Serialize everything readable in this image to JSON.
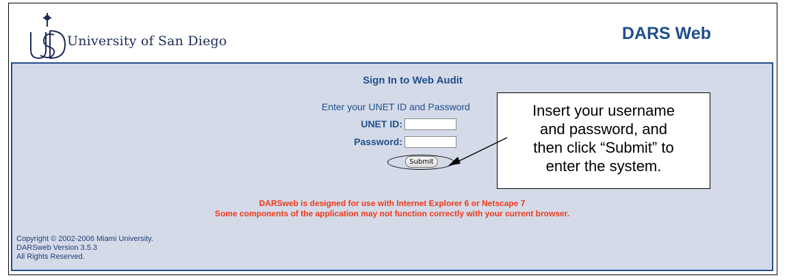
{
  "header": {
    "university_name": "University of San Diego",
    "app_title": "DARS Web"
  },
  "signin": {
    "title": "Sign In to Web Audit",
    "instructions": "Enter your UNET ID and Password",
    "unet_label": "UNET ID:",
    "password_label": "Password:",
    "unet_value": "",
    "password_value": "",
    "submit_label": "Submit"
  },
  "warning": {
    "line1": "DARSweb is designed for use with Internet Explorer 6 or Netscape 7",
    "line2": "Some components of the application may not function correctly with your current browser."
  },
  "footer": {
    "line1": "Copyright © 2002-2006 Miami University.",
    "line2": "DARSweb Version 3.5.3",
    "line3": "All Rights Reserved."
  },
  "callout": {
    "line1": "Insert your username",
    "line2": "and password, and",
    "line3": "then click “Submit” to",
    "line4": "enter the system."
  },
  "colors": {
    "brand_blue": "#1f4e8c",
    "panel_bg": "#d4dae8",
    "warning_red": "#f0391a"
  },
  "icons": {
    "logo": "usd-logo-icon",
    "arrow": "callout-arrow-icon"
  }
}
